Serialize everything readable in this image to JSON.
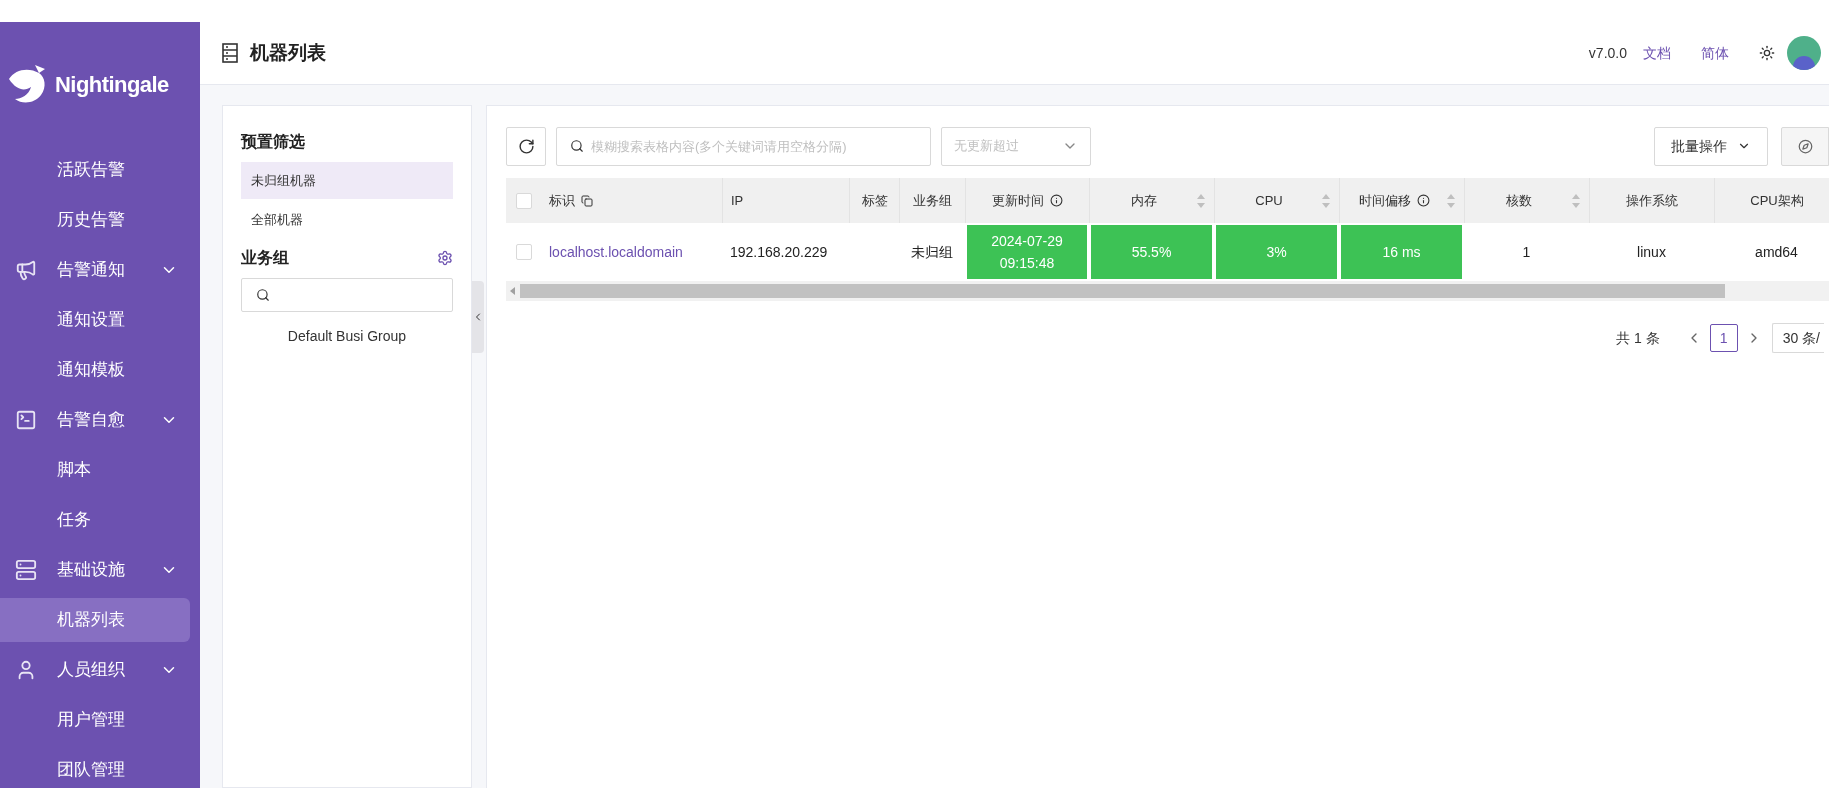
{
  "sidebar": {
    "logo": "Nightingale",
    "items": [
      {
        "kind": "link",
        "label": "活跃告警",
        "selected": false
      },
      {
        "kind": "link",
        "label": "历史告警",
        "selected": false
      },
      {
        "kind": "group",
        "label": "告警通知",
        "expanded": true,
        "children": [
          {
            "label": "通知设置",
            "selected": false
          },
          {
            "label": "通知模板",
            "selected": false
          }
        ]
      },
      {
        "kind": "group",
        "label": "告警自愈",
        "expanded": true,
        "children": [
          {
            "label": "脚本",
            "selected": false
          },
          {
            "label": "任务",
            "selected": false
          }
        ]
      },
      {
        "kind": "group",
        "label": "基础设施",
        "expanded": true,
        "children": [
          {
            "label": "机器列表",
            "selected": true
          }
        ]
      },
      {
        "kind": "group",
        "label": "人员组织",
        "expanded": true,
        "children": [
          {
            "label": "用户管理",
            "selected": false
          },
          {
            "label": "团队管理",
            "selected": false
          }
        ]
      }
    ]
  },
  "header": {
    "title": "机器列表",
    "version": "v7.0.0",
    "links": [
      "文档",
      "简体"
    ]
  },
  "filter_panel": {
    "preset_title": "预置筛选",
    "presets": [
      {
        "label": "未归组机器",
        "selected": true
      },
      {
        "label": "全部机器",
        "selected": false
      }
    ],
    "group_title": "业务组",
    "groups": [
      "Default Busi Group"
    ]
  },
  "toolbar": {
    "search": {
      "placeholder": "模糊搜索表格内容(多个关键词请用空格分隔)"
    },
    "select": {
      "placeholder": "无更新超过"
    },
    "batch_button": "批量操作"
  },
  "table": {
    "all_checked": false,
    "columns": [
      {
        "label": "标识",
        "copy": true,
        "info": false,
        "sortable": false
      },
      {
        "label": "IP",
        "copy": false,
        "info": false,
        "sortable": false
      },
      {
        "label": "标签",
        "copy": false,
        "info": false,
        "sortable": false
      },
      {
        "label": "业务组",
        "copy": false,
        "info": false,
        "sortable": false
      },
      {
        "label": "更新时间",
        "copy": false,
        "info": true,
        "sortable": false
      },
      {
        "label": "内存",
        "copy": false,
        "info": false,
        "sortable": true
      },
      {
        "label": "CPU",
        "copy": false,
        "info": false,
        "sortable": true
      },
      {
        "label": "时间偏移",
        "copy": false,
        "info": true,
        "sortable": true
      },
      {
        "label": "核数",
        "copy": false,
        "info": false,
        "sortable": true
      },
      {
        "label": "操作系统",
        "copy": false,
        "info": false,
        "sortable": false
      },
      {
        "label": "CPU架构",
        "copy": false,
        "info": false,
        "sortable": false
      }
    ],
    "rows": [
      {
        "checked": false,
        "cells": [
          {
            "kind": "link",
            "text": "localhost.localdomain"
          },
          {
            "kind": "text",
            "text": "192.168.20.229"
          },
          {
            "kind": "empty"
          },
          {
            "kind": "text",
            "text": "未归组"
          },
          {
            "kind": "status",
            "lines": [
              "2024-07-29",
              "09:15:48"
            ],
            "color": "#3dc255"
          },
          {
            "kind": "status",
            "lines": [
              "55.5%"
            ],
            "color": "#3dc255"
          },
          {
            "kind": "status",
            "lines": [
              "3%"
            ],
            "color": "#3dc255"
          },
          {
            "kind": "status",
            "lines": [
              "16 ms"
            ],
            "color": "#3dc255"
          },
          {
            "kind": "text",
            "text": "1"
          },
          {
            "kind": "text",
            "text": "linux"
          },
          {
            "kind": "text",
            "text": "amd64"
          }
        ]
      }
    ]
  },
  "pagination": {
    "total": "共 1 条",
    "pages": [
      {
        "label": "1",
        "selected": true
      }
    ],
    "page_size": "30 条/"
  }
}
